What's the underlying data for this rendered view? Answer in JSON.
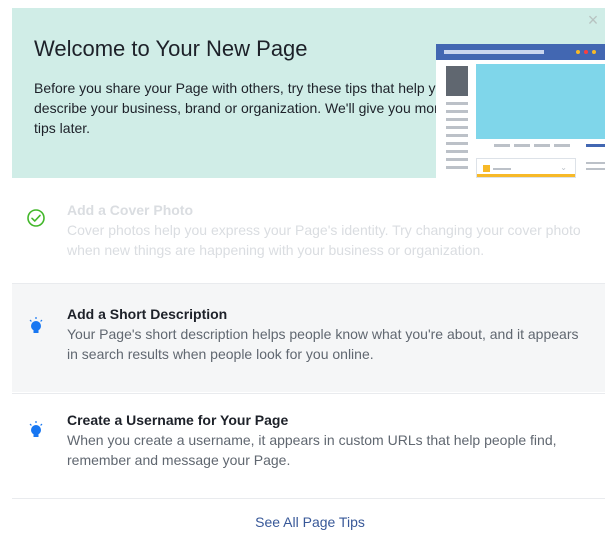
{
  "dialog": {
    "close_label": "×",
    "title": "Welcome to Your New Page",
    "intro": "Before you share your Page with others, try these tips that help you describe your business, brand or organization. We'll give you more tips later."
  },
  "tips": [
    {
      "title": "Add a Cover Photo",
      "description": "Cover photos help you express your Page's identity. Try changing your cover photo when new things are happening with your business or organization.",
      "status": "completed",
      "icon": "check-circle-icon"
    },
    {
      "title": "Add a Short Description",
      "description": "Your Page's short description helps people know what you're about, and it appears in search results when people look for you online.",
      "status": "highlighted",
      "icon": "lightbulb-icon"
    },
    {
      "title": "Create a Username for Your Page",
      "description": "When you create a username, it appears in custom URLs that help people find, remember and message your Page.",
      "status": "pending",
      "icon": "lightbulb-icon"
    }
  ],
  "footer": {
    "link_label": "See All Page Tips"
  },
  "colors": {
    "header_bg": "#d0ede7",
    "link": "#385898",
    "check": "#42b72a",
    "bulb": "#1877f2",
    "brand": "#4267b2"
  }
}
